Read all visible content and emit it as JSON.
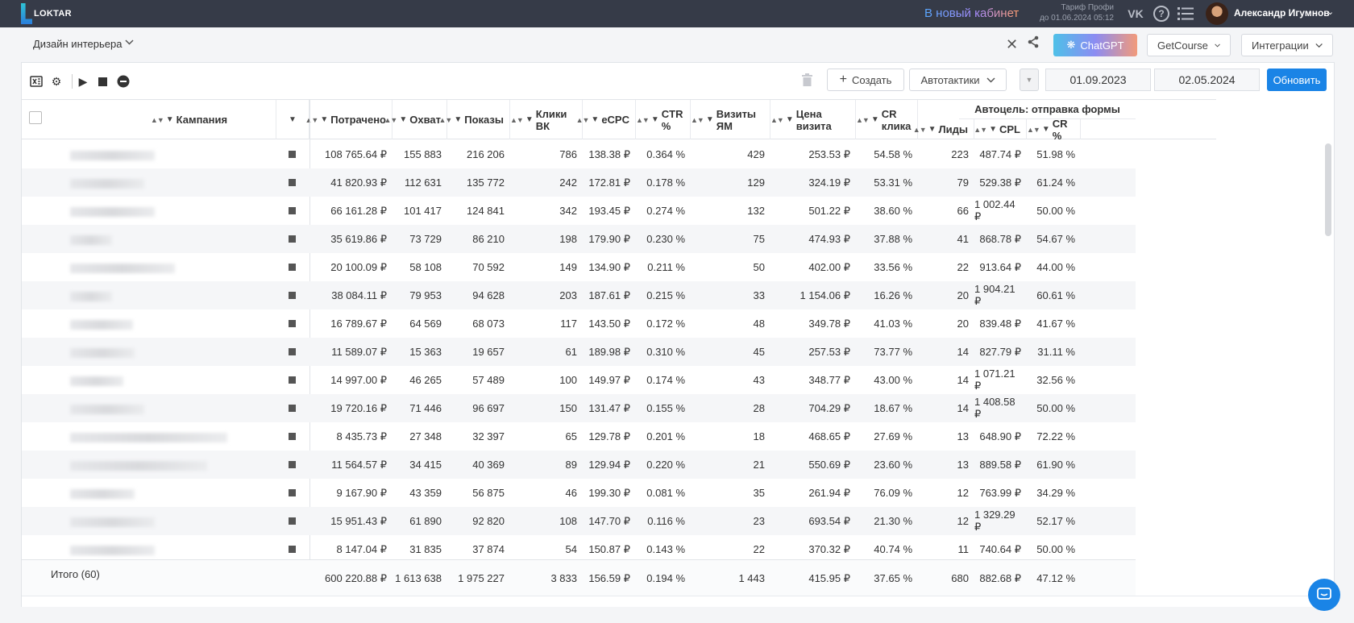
{
  "topbar": {
    "logo_text": "LOKTAR",
    "new_cabinet": "В новый кабинет",
    "tariff_line1": "Тариф Профи",
    "tariff_line2": "до 01.06.2024 05:12",
    "user_name": "Александр Игумнов"
  },
  "toolbar": {
    "breadcrumb": "Дизайн интерьера",
    "chatgpt_label": "ChatGPT",
    "getcourse_label": "GetCourse",
    "integrations_label": "Интеграции"
  },
  "panel": {
    "create_label": "Создать",
    "autotactics_label": "Автотактики",
    "date_from": "01.09.2023",
    "date_to": "02.05.2024",
    "update_label": "Обновить"
  },
  "table": {
    "campaign_header": "Кампания",
    "group_header": "Автоцель: отправка формы",
    "columns": [
      "Потрачено",
      "Охват",
      "Показы",
      "Клики ВК",
      "eCPC",
      "CTR %",
      "Визиты ЯМ",
      "Цена визита",
      "CR клика",
      "Лиды",
      "CPL",
      "CR %"
    ],
    "rows": [
      [
        "108 765.64 ₽",
        "155 883",
        "216 206",
        "786",
        "138.38 ₽",
        "0.364 %",
        "429",
        "253.53 ₽",
        "54.58 %",
        "223",
        "487.74 ₽",
        "51.98 %"
      ],
      [
        "41 820.93 ₽",
        "112 631",
        "135 772",
        "242",
        "172.81 ₽",
        "0.178 %",
        "129",
        "324.19 ₽",
        "53.31 %",
        "79",
        "529.38 ₽",
        "61.24 %"
      ],
      [
        "66 161.28 ₽",
        "101 417",
        "124 841",
        "342",
        "193.45 ₽",
        "0.274 %",
        "132",
        "501.22 ₽",
        "38.60 %",
        "66",
        "1 002.44 ₽",
        "50.00 %"
      ],
      [
        "35 619.86 ₽",
        "73 729",
        "86 210",
        "198",
        "179.90 ₽",
        "0.230 %",
        "75",
        "474.93 ₽",
        "37.88 %",
        "41",
        "868.78 ₽",
        "54.67 %"
      ],
      [
        "20 100.09 ₽",
        "58 108",
        "70 592",
        "149",
        "134.90 ₽",
        "0.211 %",
        "50",
        "402.00 ₽",
        "33.56 %",
        "22",
        "913.64 ₽",
        "44.00 %"
      ],
      [
        "38 084.11 ₽",
        "79 953",
        "94 628",
        "203",
        "187.61 ₽",
        "0.215 %",
        "33",
        "1 154.06 ₽",
        "16.26 %",
        "20",
        "1 904.21 ₽",
        "60.61 %"
      ],
      [
        "16 789.67 ₽",
        "64 569",
        "68 073",
        "117",
        "143.50 ₽",
        "0.172 %",
        "48",
        "349.78 ₽",
        "41.03 %",
        "20",
        "839.48 ₽",
        "41.67 %"
      ],
      [
        "11 589.07 ₽",
        "15 363",
        "19 657",
        "61",
        "189.98 ₽",
        "0.310 %",
        "45",
        "257.53 ₽",
        "73.77 %",
        "14",
        "827.79 ₽",
        "31.11 %"
      ],
      [
        "14 997.00 ₽",
        "46 265",
        "57 489",
        "100",
        "149.97 ₽",
        "0.174 %",
        "43",
        "348.77 ₽",
        "43.00 %",
        "14",
        "1 071.21 ₽",
        "32.56 %"
      ],
      [
        "19 720.16 ₽",
        "71 446",
        "96 697",
        "150",
        "131.47 ₽",
        "0.155 %",
        "28",
        "704.29 ₽",
        "18.67 %",
        "14",
        "1 408.58 ₽",
        "50.00 %"
      ],
      [
        "8 435.73 ₽",
        "27 348",
        "32 397",
        "65",
        "129.78 ₽",
        "0.201 %",
        "18",
        "468.65 ₽",
        "27.69 %",
        "13",
        "648.90 ₽",
        "72.22 %"
      ],
      [
        "11 564.57 ₽",
        "34 415",
        "40 369",
        "89",
        "129.94 ₽",
        "0.220 %",
        "21",
        "550.69 ₽",
        "23.60 %",
        "13",
        "889.58 ₽",
        "61.90 %"
      ],
      [
        "9 167.90 ₽",
        "43 359",
        "56 875",
        "46",
        "199.30 ₽",
        "0.081 %",
        "35",
        "261.94 ₽",
        "76.09 %",
        "12",
        "763.99 ₽",
        "34.29 %"
      ],
      [
        "15 951.43 ₽",
        "61 890",
        "92 820",
        "108",
        "147.70 ₽",
        "0.116 %",
        "23",
        "693.54 ₽",
        "21.30 %",
        "12",
        "1 329.29 ₽",
        "52.17 %"
      ],
      [
        "8 147.04 ₽",
        "31 835",
        "37 874",
        "54",
        "150.87 ₽",
        "0.143 %",
        "22",
        "370.32 ₽",
        "40.74 %",
        "11",
        "740.64 ₽",
        "50.00 %"
      ]
    ],
    "footer_label": "Итого (60)",
    "footer": [
      "600 220.88 ₽",
      "1 613 638",
      "1 975 227",
      "3 833",
      "156.59 ₽",
      "0.194 %",
      "1 443",
      "415.95 ₽",
      "37.65 %",
      "680",
      "882.68 ₽",
      "47.12 %"
    ]
  }
}
